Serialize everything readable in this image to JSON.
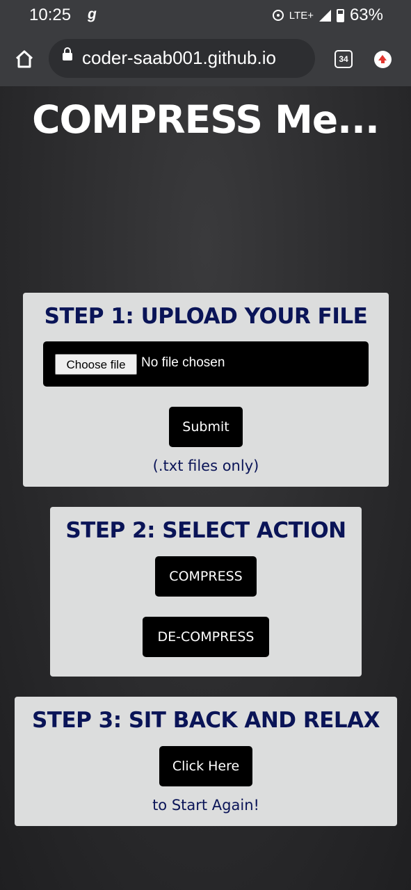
{
  "status_bar": {
    "time": "10:25",
    "app_icon": "g",
    "network": "LTE+",
    "battery": "63%"
  },
  "browser": {
    "url": "coder-saab001.github.io",
    "tab_count": "34"
  },
  "page": {
    "title": "COMPRESS Me...",
    "step1": {
      "heading": "STEP 1: UPLOAD YOUR FILE",
      "choose_label": "Choose file",
      "file_status": "No file chosen",
      "submit_label": "Submit",
      "note": "(.txt files only)"
    },
    "step2": {
      "heading": "STEP 2: SELECT ACTION",
      "compress_label": "COMPRESS",
      "decompress_label": "DE-COMPRESS"
    },
    "step3": {
      "heading": "STEP 3: SIT BACK AND RELAX",
      "click_label": "Click Here",
      "note": "to Start Again!"
    }
  },
  "colors": {
    "heading": "#0a1457",
    "card": "#dcdddd",
    "button": "#000000"
  }
}
